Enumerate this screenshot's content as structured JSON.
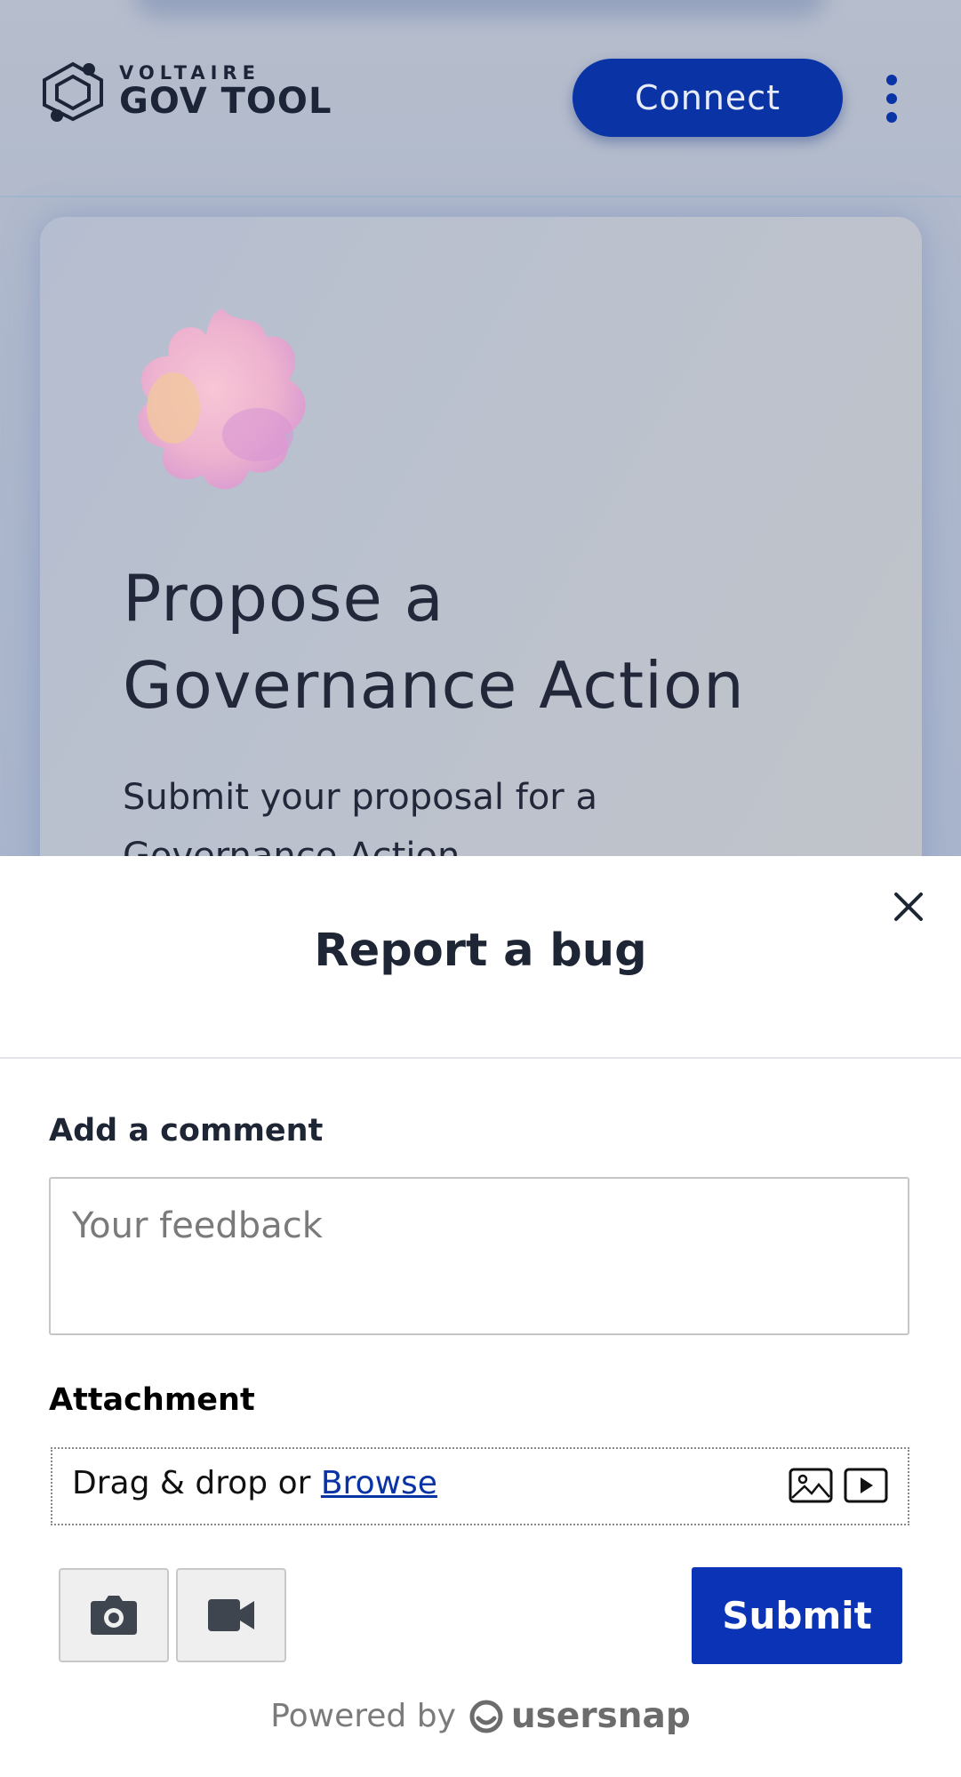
{
  "app": {
    "logo_small": "VOLTAIRE",
    "logo_big": "GOV TOOL",
    "connect_label": "Connect",
    "menu_icon": "kebab-menu-icon"
  },
  "card": {
    "title": "Propose a Governance Action",
    "subtitle": "Submit your proposal for a Governance Action"
  },
  "bug_report": {
    "title": "Report a bug",
    "close_icon": "close-icon",
    "comment_label": "Add a comment",
    "comment_value": "",
    "comment_placeholder": "Your feedback",
    "attachment_label": "Attachment",
    "drop_text": "Drag & drop or",
    "browse_label": "Browse",
    "screenshot_icon": "camera-icon",
    "record_icon": "video-icon",
    "submit_label": "Submit",
    "powered_by": "Powered by",
    "brand": "usersnap"
  },
  "colors": {
    "primary": "#0a33a6",
    "submit": "#0a33b5",
    "text_dark": "#1e2535"
  }
}
